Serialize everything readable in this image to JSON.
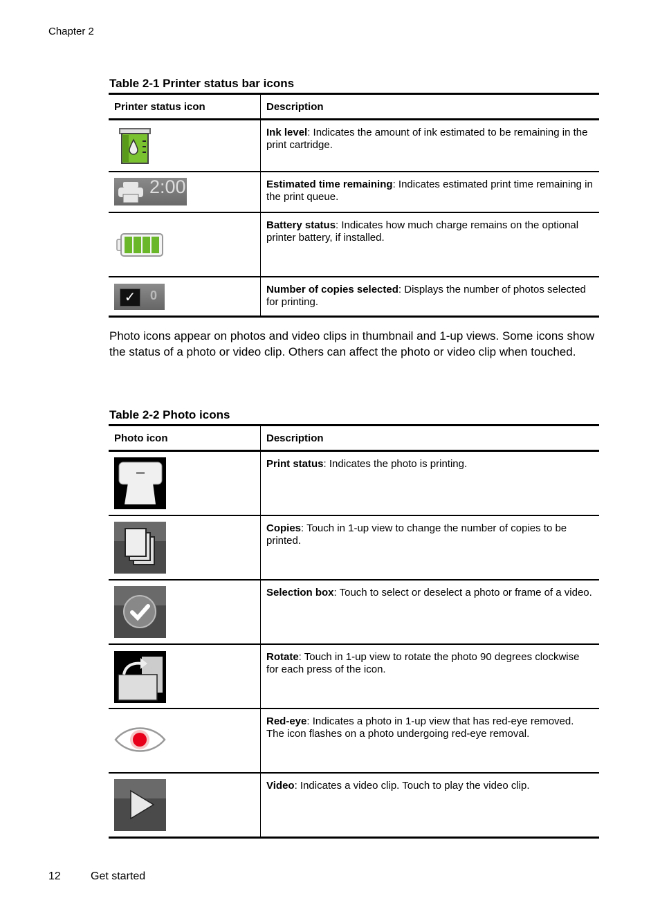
{
  "running_head": "Chapter 2",
  "table1": {
    "caption": "Table 2-1 Printer status bar icons",
    "headers": [
      "Printer status icon",
      "Description"
    ],
    "rows": [
      {
        "icon": "ink-level-icon",
        "term": "Ink level",
        "text": ": Indicates the amount of ink estimated to be remaining in the print cartridge."
      },
      {
        "icon": "time-remaining-icon",
        "icon_text": "2:00",
        "term": "Estimated time remaining",
        "text": ": Indicates estimated print time remaining in the print queue."
      },
      {
        "icon": "battery-icon",
        "term": "Battery status",
        "text": ": Indicates how much charge remains on the optional printer battery, if installed."
      },
      {
        "icon": "copies-selected-icon",
        "icon_text": "0",
        "term": "Number of copies selected",
        "text": ": Displays the number of photos selected for printing."
      }
    ]
  },
  "paragraph": "Photo icons appear on photos and video clips in thumbnail and 1-up views. Some icons show the status of a photo or video clip. Others can affect the photo or video clip when touched.",
  "table2": {
    "caption": "Table 2-2 Photo icons",
    "headers": [
      "Photo icon",
      "Description"
    ],
    "rows": [
      {
        "icon": "print-status-icon",
        "term": "Print status",
        "text": ": Indicates the photo is printing."
      },
      {
        "icon": "copies-icon",
        "term": "Copies",
        "text": ": Touch in 1-up view to change the number of copies to be printed."
      },
      {
        "icon": "selection-box-icon",
        "term": "Selection box",
        "text": ": Touch to select or deselect a photo or frame of a video."
      },
      {
        "icon": "rotate-icon",
        "term": "Rotate",
        "text": ": Touch in 1-up view to rotate the photo 90 degrees clockwise for each press of the icon."
      },
      {
        "icon": "red-eye-icon",
        "term": "Red-eye",
        "text": ": Indicates a photo in 1-up view that has red-eye removed. The icon flashes on a photo undergoing red-eye removal."
      },
      {
        "icon": "video-icon",
        "term": "Video",
        "text": ": Indicates a video clip. Touch to play the video clip."
      }
    ]
  },
  "footer": {
    "page_number": "12",
    "section": "Get started"
  }
}
